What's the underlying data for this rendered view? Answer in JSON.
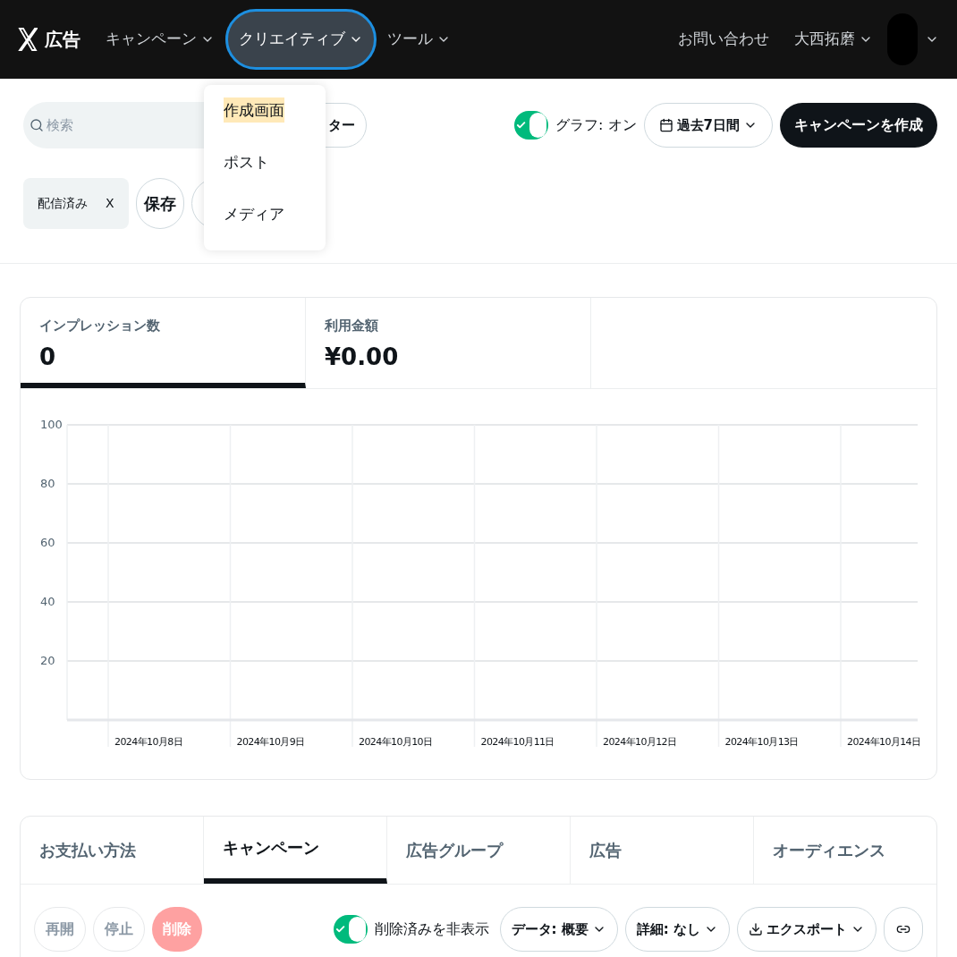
{
  "header": {
    "logo": "広告",
    "nav": [
      {
        "label": "キャンペーン",
        "selected": false
      },
      {
        "label": "クリエイティブ",
        "selected": true
      },
      {
        "label": "ツール",
        "selected": false
      }
    ],
    "contact": "お問い合わせ",
    "user": "大西拓磨"
  },
  "dropdown": {
    "items": [
      {
        "label": "作成画面",
        "selected": true
      },
      {
        "label": "ポスト",
        "selected": false
      },
      {
        "label": "メディア",
        "selected": false
      }
    ]
  },
  "toolbar": {
    "search": {
      "placeholder": "検索"
    },
    "filter_button": "ター",
    "graph_toggle": {
      "label": "グラフ: オン",
      "on": true
    },
    "date_range": "過去7日間",
    "create_button": "キャンペーンを作成"
  },
  "filters": {
    "chips": [
      "配信済み"
    ],
    "chip_remove": "X",
    "save_button": "保存"
  },
  "metrics": [
    {
      "label": "インプレッション数",
      "value": "0",
      "selected": true
    },
    {
      "label": "利用金額",
      "value": "¥0.00",
      "selected": false
    }
  ],
  "chart_data": {
    "type": "line",
    "categories": [
      "2024年10月8日",
      "2024年10月9日",
      "2024年10月10日",
      "2024年10月11日",
      "2024年10月12日",
      "2024年10月13日",
      "2024年10月14日"
    ],
    "grid": true,
    "ylim": [
      0,
      100
    ],
    "yticks": [
      20,
      40,
      60,
      80,
      100
    ]
  },
  "tabs": [
    {
      "label": "お支払い方法",
      "selected": false
    },
    {
      "label": "キャンペーン",
      "selected": true
    },
    {
      "label": "広告グループ",
      "selected": false
    },
    {
      "label": "広告",
      "selected": false
    },
    {
      "label": "オーディエンス",
      "selected": false
    }
  ],
  "actions": [
    {
      "label": "再開",
      "kind": "plain"
    },
    {
      "label": "停止",
      "kind": "plain"
    },
    {
      "label": "削除",
      "kind": "danger"
    }
  ],
  "hide_deleted": {
    "label": "削除済みを非表示",
    "on": true
  },
  "options": [
    {
      "label": "データ: 概要",
      "kind": "dropdown"
    },
    {
      "label": "詳細: なし",
      "kind": "dropdown"
    },
    {
      "label": "エクスポート",
      "kind": "export"
    }
  ]
}
